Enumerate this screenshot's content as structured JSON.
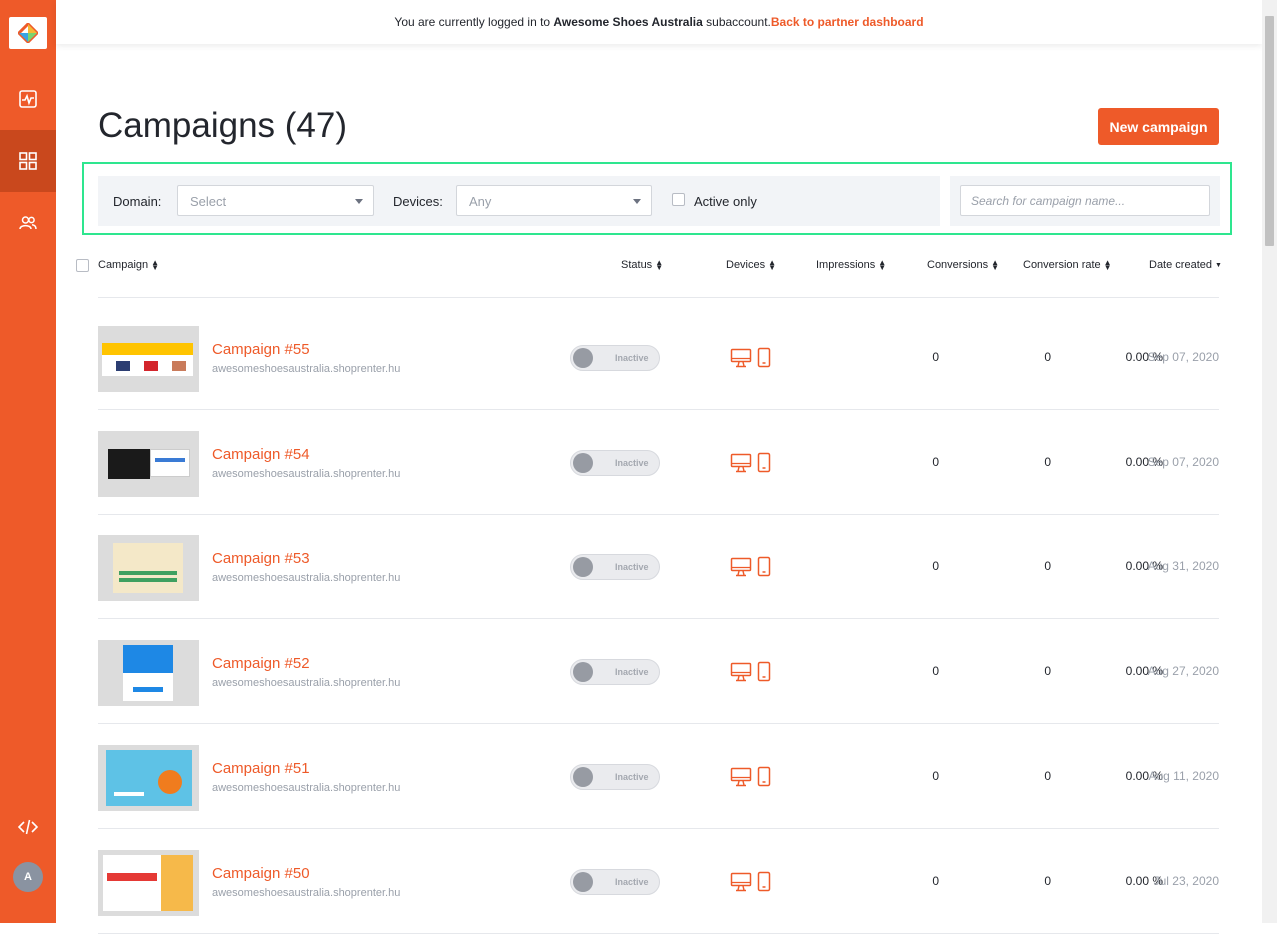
{
  "topbar": {
    "prefix": "You are currently logged in to ",
    "account": "Awesome Shoes Australia",
    "suffix": " subaccount.",
    "link": "Back to partner dashboard"
  },
  "page": {
    "title": "Campaigns (47)",
    "new_button": "New campaign"
  },
  "filters": {
    "domain_label": "Domain:",
    "domain_value": "Select",
    "devices_label": "Devices:",
    "devices_value": "Any",
    "active_only_label": "Active only",
    "search_placeholder": "Search for campaign name..."
  },
  "table": {
    "headers": [
      "Campaign",
      "Status",
      "Devices",
      "Impressions",
      "Conversions",
      "Conversion rate",
      "Date created"
    ],
    "rows": [
      {
        "name": "Campaign #55",
        "domain": "awesomeshoesaustralia.shoprenter.hu",
        "status": "Inactive",
        "impressions": "0",
        "conversions": "0",
        "rate": "0.00 %",
        "date": "Sep 07, 2020"
      },
      {
        "name": "Campaign #54",
        "domain": "awesomeshoesaustralia.shoprenter.hu",
        "status": "Inactive",
        "impressions": "0",
        "conversions": "0",
        "rate": "0.00 %",
        "date": "Sep 07, 2020"
      },
      {
        "name": "Campaign #53",
        "domain": "awesomeshoesaustralia.shoprenter.hu",
        "status": "Inactive",
        "impressions": "0",
        "conversions": "0",
        "rate": "0.00 %",
        "date": "Aug 31, 2020"
      },
      {
        "name": "Campaign #52",
        "domain": "awesomeshoesaustralia.shoprenter.hu",
        "status": "Inactive",
        "impressions": "0",
        "conversions": "0",
        "rate": "0.00 %",
        "date": "Aug 27, 2020"
      },
      {
        "name": "Campaign #51",
        "domain": "awesomeshoesaustralia.shoprenter.hu",
        "status": "Inactive",
        "impressions": "0",
        "conversions": "0",
        "rate": "0.00 %",
        "date": "Aug 11, 2020"
      },
      {
        "name": "Campaign #50",
        "domain": "awesomeshoesaustralia.shoprenter.hu",
        "status": "Inactive",
        "impressions": "0",
        "conversions": "0",
        "rate": "0.00 %",
        "date": "Jul 23, 2020"
      }
    ]
  },
  "sidebar": {
    "icons": [
      "analytics-icon",
      "campaigns-icon",
      "subscribers-icon",
      "code-icon"
    ],
    "avatar_initial": "A"
  },
  "colors": {
    "brand": "#ee5a29",
    "highlight": "#2ee68f"
  }
}
